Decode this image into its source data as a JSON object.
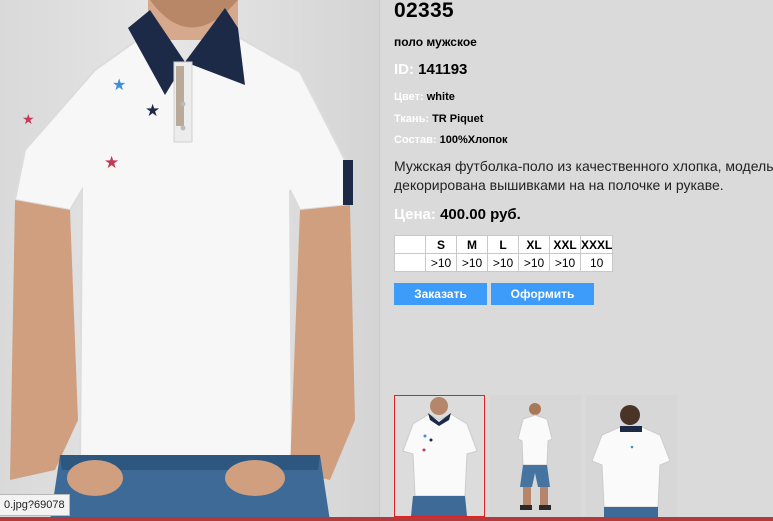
{
  "product": {
    "sku": "02335",
    "subtitle": "поло мужское",
    "id_label": "ID:",
    "id_value": "141193",
    "specs": [
      {
        "label": "Цвет:",
        "value": "white"
      },
      {
        "label": "Ткань:",
        "value": "TR Piquet"
      },
      {
        "label": "Состав:",
        "value": "100%Хлопок"
      }
    ],
    "description": [
      "Мужская футболка-поло из качественного хлопка, модель",
      "декорирована вышивками на  на полочке и рукаве."
    ],
    "price_label": "Цена:",
    "price_value": "400.00 руб."
  },
  "sizes": {
    "headers": [
      "",
      "S",
      "M",
      "L",
      "XL",
      "XXL",
      "XXXL"
    ],
    "stock": [
      "",
      ">10",
      ">10",
      ">10",
      ">10",
      ">10",
      "10"
    ]
  },
  "buttons": {
    "order": "Заказать",
    "checkout": "Оформить"
  },
  "status_url": "0.jpg?69078",
  "colors": {
    "accent_blue": "#3d9bfa",
    "panel_bg": "#dadada",
    "thumb_selected_border": "#dd2222"
  }
}
